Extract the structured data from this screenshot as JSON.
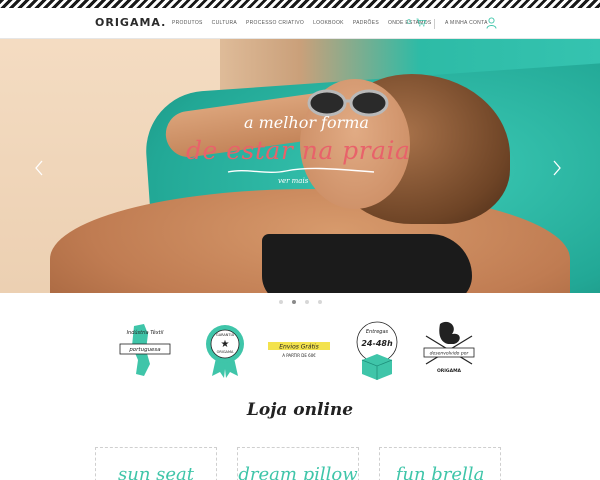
{
  "header": {
    "logo": "ORIGAMA.",
    "nav": [
      "PRODUTOS",
      "CULTURA",
      "PROCESSO CRIATIVO",
      "LOOKBOOK",
      "PADRÕES",
      "ONDE ESTAMOS"
    ],
    "cart_count": "0",
    "account_label": "A MINHA CONTA"
  },
  "hero": {
    "line1": "a melhor forma",
    "line2": "de estar na praia",
    "cta": "ver mais",
    "slides_total": 4,
    "active_slide": 2
  },
  "badges": [
    {
      "name": "industria-textil-portuguesa",
      "lines": [
        "Indústria Têxtil",
        "portuguesa"
      ]
    },
    {
      "name": "garantia-origama",
      "lines": [
        "GARANTIA",
        "ORIGAMA"
      ]
    },
    {
      "name": "envios-gratis",
      "lines": [
        "Envios Grátis",
        "A PARTIR DE 60€"
      ]
    },
    {
      "name": "entregas-24-48h",
      "lines": [
        "Entregas",
        "24-48h"
      ]
    },
    {
      "name": "desenvolvido-por-origama",
      "lines": [
        "desenvolvido por",
        "ORIGAMA"
      ]
    }
  ],
  "section": {
    "title": "Loja online"
  },
  "products": [
    "sun seat",
    "dream pillow",
    "fun brella"
  ],
  "colors": {
    "accent": "#3fc5a9",
    "hero_script": "#e8626a"
  }
}
